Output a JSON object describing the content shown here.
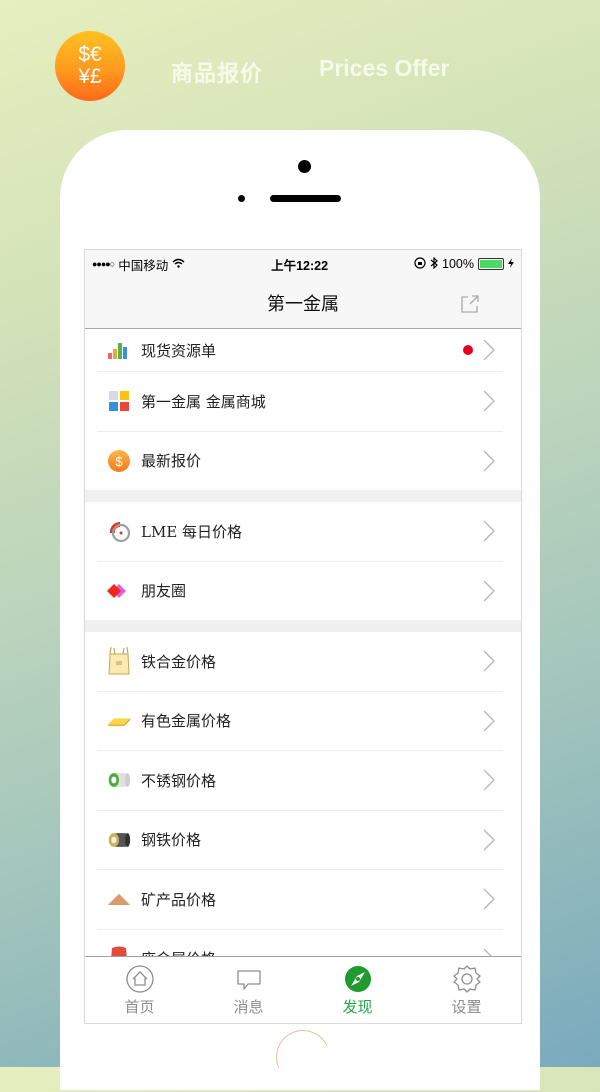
{
  "promo": {
    "logo_top": "$€",
    "logo_bottom": "¥£",
    "title_cn": "商品报价",
    "title_en": "Prices Offer"
  },
  "status_bar": {
    "signal": "●●●●○",
    "carrier": "中国移动",
    "time": "上午12:22",
    "battery": "100%"
  },
  "nav": {
    "title": "第一金属"
  },
  "groups": [
    {
      "items": [
        {
          "label": "现货资源单",
          "icon": "bar-chart-icon",
          "badge": true
        },
        {
          "label": "第一金属 金属商城",
          "icon": "store-grid-icon",
          "badge": false
        },
        {
          "label": "最新报价",
          "icon": "dollar-coin-icon",
          "badge": false
        }
      ]
    },
    {
      "items": [
        {
          "label": "LME 每日价格",
          "icon": "lme-gauge-icon",
          "badge": false
        },
        {
          "label": "朋友圈",
          "icon": "moments-diamond-icon",
          "badge": false
        }
      ]
    },
    {
      "items": [
        {
          "label": "铁合金价格",
          "icon": "ton-bag-icon",
          "badge": false
        },
        {
          "label": "有色金属价格",
          "icon": "gold-bar-icon",
          "badge": false
        },
        {
          "label": "不锈钢价格",
          "icon": "stainless-coil-icon",
          "badge": false
        },
        {
          "label": "钢铁价格",
          "icon": "steel-coil-icon",
          "badge": false
        },
        {
          "label": "矿产品价格",
          "icon": "ore-pile-icon",
          "badge": false
        },
        {
          "label": "废金属价格",
          "icon": "scrap-bag-icon",
          "badge": false
        }
      ]
    }
  ],
  "tabbar": {
    "tabs": [
      {
        "label": "首页",
        "icon": "home-icon",
        "active": false
      },
      {
        "label": "消息",
        "icon": "message-icon",
        "active": false
      },
      {
        "label": "发现",
        "icon": "discover-compass-icon",
        "active": true
      },
      {
        "label": "设置",
        "icon": "settings-gear-icon",
        "active": false
      }
    ]
  },
  "colors": {
    "accent_green": "#2aa44a",
    "badge_red": "#e8001c",
    "battery_green": "#4cd964"
  }
}
